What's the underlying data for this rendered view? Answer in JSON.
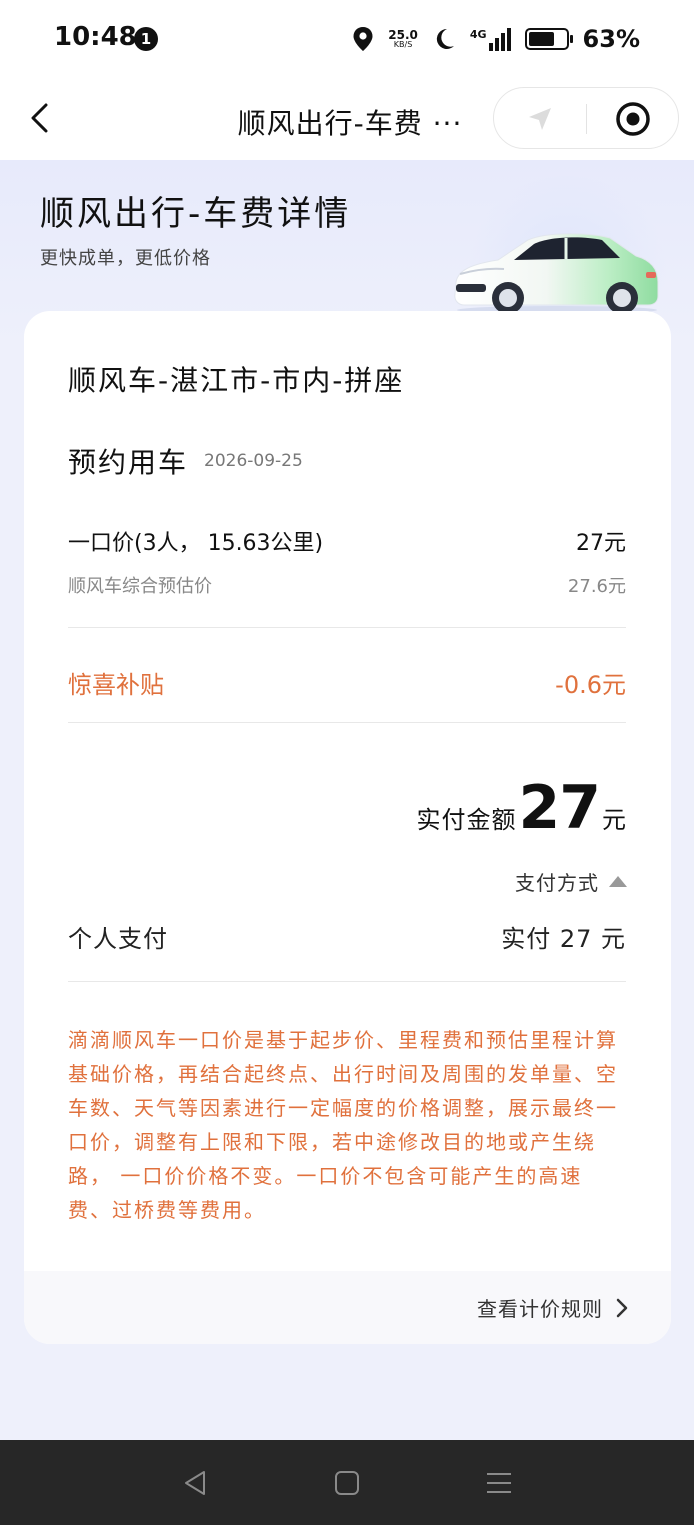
{
  "status_bar": {
    "time": "10:48",
    "notification_count": "1",
    "net_speed_value": "25.0",
    "net_speed_unit": "KB/S",
    "network_type": "4G",
    "battery_percent": "63%",
    "battery_level": 0.63
  },
  "header": {
    "title": "顺风出行-车费 ···"
  },
  "hero": {
    "title": "顺风出行-车费详情",
    "subtitle": "更快成单，更低价格"
  },
  "card": {
    "route": "顺风车-湛江市-市内-拼座",
    "booking_label": "预约用车",
    "booking_date": "2026-09-25",
    "fixed_price_label": "一口价(3人， 15.63公里)",
    "fixed_price_value": "27元",
    "estimate_label": "顺风车综合预估价",
    "estimate_value": "27.6元",
    "subsidy_label": "惊喜补贴",
    "subsidy_value": "-0.6元",
    "paid_label": "实付金额",
    "paid_amount": "27",
    "paid_unit": "元",
    "payment_method_label": "支付方式",
    "personal_pay_label": "个人支付",
    "personal_pay_value": "实付 27 元",
    "note": "滴滴顺风车一口价是基于起步价、里程费和预估里程计算基础价格，再结合起终点、出行时间及周围的发单量、空车数、天气等因素进行一定幅度的价格调整，展示最终一口价，调整有上限和下限，若中途修改目的地或产生绕路， 一口价价格不变。一口价不包含可能产生的高速费、过桥费等费用。",
    "rule_link": "查看计价规则"
  },
  "colors": {
    "accent_orange": "#e0713d",
    "background": "#eef0fb",
    "car_green": "#b7ecc0"
  },
  "icons": {
    "back": "chevron-left-icon",
    "navigation": "navigation-arrow-icon",
    "target": "target-icon",
    "rule_arrow": "chevron-right-icon"
  }
}
